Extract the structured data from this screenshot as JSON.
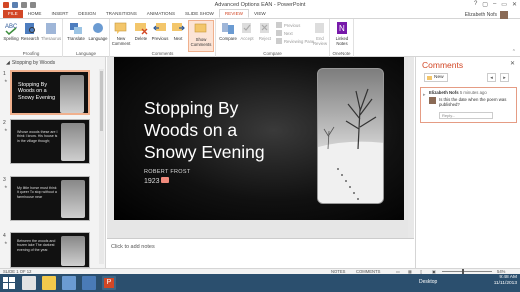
{
  "window": {
    "title": "Advanced Options EAN - PowerPoint",
    "controls": [
      "?",
      "▢",
      "–",
      "▭",
      "✕"
    ]
  },
  "tabs": [
    "FILE",
    "HOME",
    "INSERT",
    "DESIGN",
    "TRANSITIONS",
    "ANIMATIONS",
    "SLIDE SHOW",
    "REVIEW",
    "VIEW"
  ],
  "active_tab": "REVIEW",
  "user": {
    "name": "Elizabeth Nofs"
  },
  "ribbon": {
    "groups": {
      "proofing": "Proofing",
      "language": "Language",
      "comments": "Comments",
      "compare": "Compare",
      "onenote": "OneNote"
    },
    "buttons": {
      "spelling": "Spelling",
      "research": "Research",
      "thesaurus": "Thesaurus",
      "translate": "Translate",
      "language": "Language",
      "new_comment": "New Comment",
      "delete": "Delete",
      "previous": "Previous",
      "next": "Next",
      "show_comments": "Show Comments",
      "compare": "Compare",
      "accept": "Accept",
      "reject": "Reject",
      "prev_small": "Previous",
      "next_small": "Next",
      "reviewing_pane": "Reviewing Pane",
      "end_review": "End Review",
      "linked_notes": "Linked Notes"
    }
  },
  "left_panel": {
    "title": "Stopping by Woods",
    "slides": [
      {
        "num": "1",
        "text": "Stopping By Woods on a Snowy Evening"
      },
      {
        "num": "2",
        "text": "Whose woods these are I think I know. His house is in the village though;"
      },
      {
        "num": "3",
        "text": "My little horse must think it queer To stop without a farmhouse near"
      },
      {
        "num": "4",
        "text": "Between the woods and frozen lake The darkest evening of the year."
      }
    ]
  },
  "slide": {
    "title": "Stopping By Woods on a Snowy Evening",
    "author": "ROBERT FROST",
    "year": "1923"
  },
  "notes_placeholder": "Click to add notes",
  "comments": {
    "title": "Comments",
    "close": "✕",
    "new_label": "New",
    "items": [
      {
        "author": "Elizabeth Nofs",
        "time": "5 minutes ago",
        "text": "Is this the date when the poem was published?",
        "reply_placeholder": "Reply..."
      }
    ]
  },
  "status": {
    "slide_info": "SLIDE 1 OF 12",
    "notes": "NOTES",
    "comments": "COMMENTS",
    "zoom": "54%"
  },
  "taskbar": {
    "desktop": "Desktop",
    "time": "9:48 AM",
    "date": "11/11/2013"
  },
  "colors": {
    "accent": "#d24726",
    "taskbar": "#2b4f6e"
  }
}
